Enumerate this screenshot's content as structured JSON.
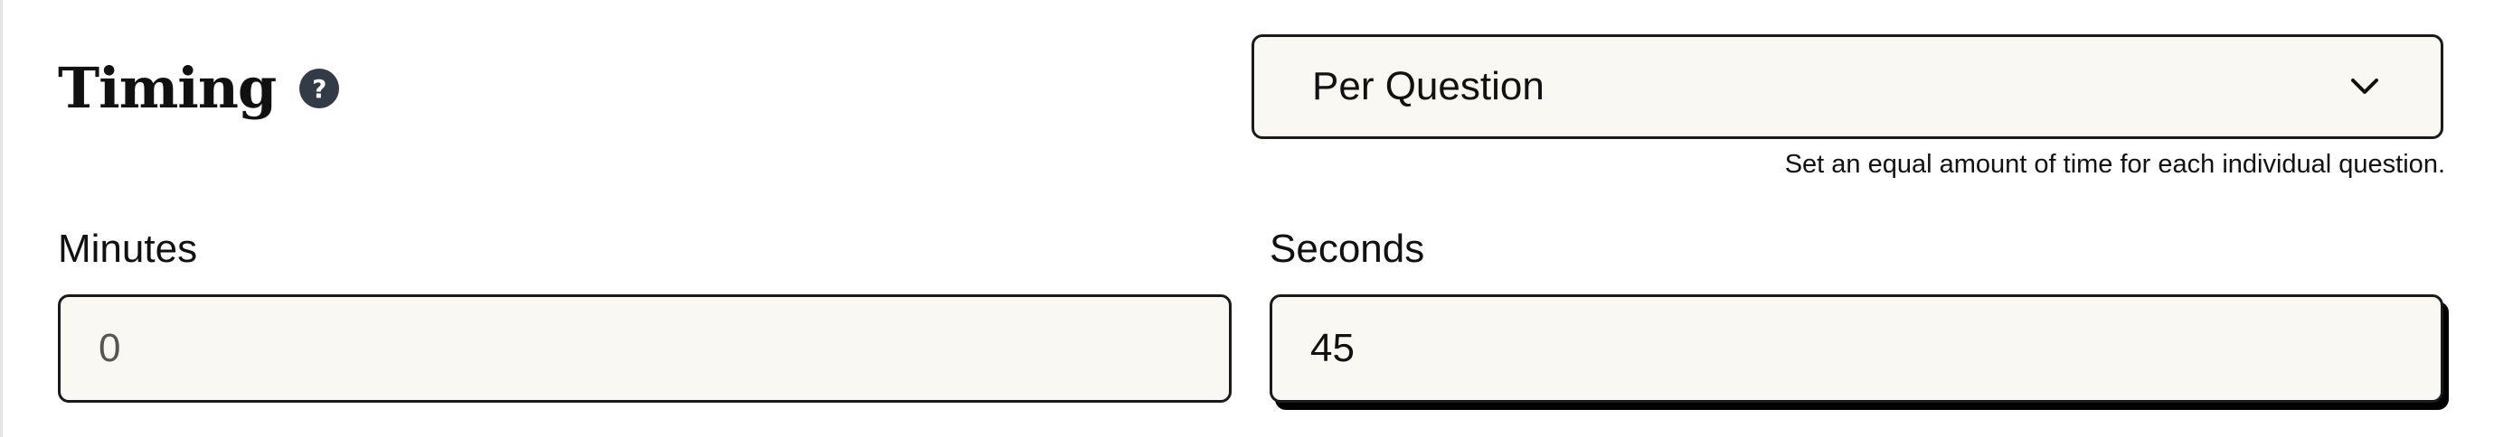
{
  "timing": {
    "title": "Timing",
    "help_icon": "question-circle-icon",
    "mode": {
      "selected": "Per Question",
      "hint": "Set an equal amount of time for each individual question.",
      "chevron_icon": "chevron-down-icon"
    },
    "minutes": {
      "label": "Minutes",
      "value": "0"
    },
    "seconds": {
      "label": "Seconds",
      "value": "45"
    }
  },
  "colors": {
    "field_background": "#faf8f2",
    "border": "#1a1a1a",
    "help_icon_background": "#333b46"
  }
}
